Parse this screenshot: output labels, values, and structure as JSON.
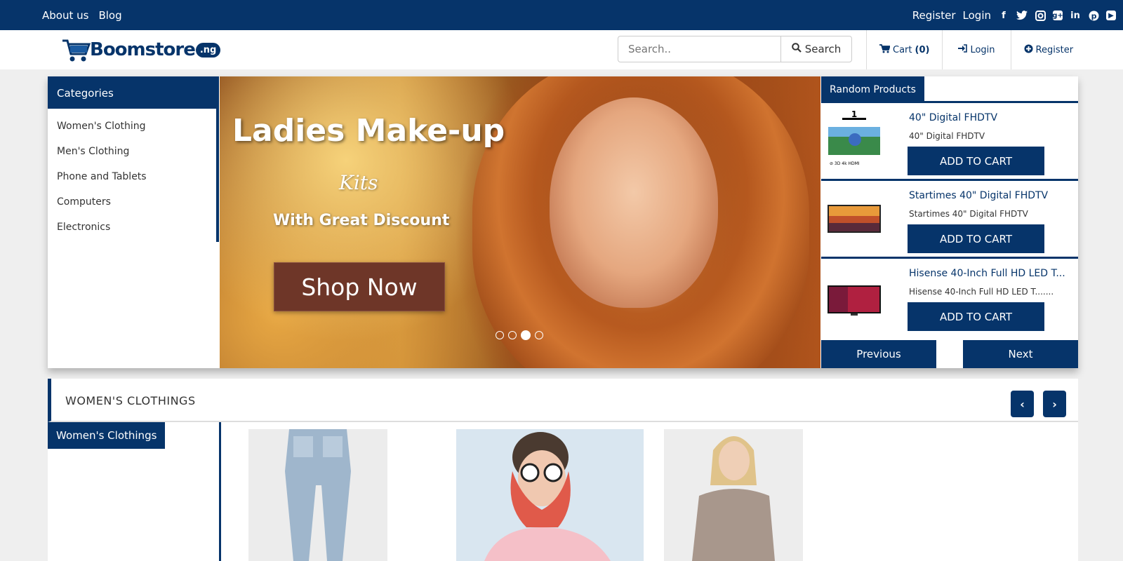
{
  "topbar": {
    "left_links": [
      "About us",
      "Blog"
    ],
    "register": "Register",
    "login": "Login"
  },
  "header": {
    "logo_name": "Boomstore",
    "logo_tld": ".ng",
    "search_placeholder": "Search..",
    "search_button": "Search",
    "cart_label": "Cart",
    "cart_count": "(0)",
    "login": "Login",
    "register": "Register"
  },
  "categories": {
    "title": "Categories",
    "items": [
      "Women's Clothing",
      "Men's Clothing",
      "Phone and Tablets",
      "Computers",
      "Electronics"
    ]
  },
  "banner": {
    "title": "Ladies Make-up",
    "kits": "Kits",
    "subtitle": "With Great Discount",
    "cta": "Shop Now",
    "slides_total": 4,
    "active_slide": 3
  },
  "random_products": {
    "title": "Random Products",
    "items": [
      {
        "title": "40\" Digital FHDTV",
        "desc": "40\" Digital FHDTV",
        "button": "ADD TO CART"
      },
      {
        "title": "Startimes 40\" Digital FHDTV",
        "desc": "Startimes 40\" Digital FHDTV",
        "button": "ADD TO CART"
      },
      {
        "title": "Hisense 40-Inch Full HD LED T...",
        "desc": "Hisense 40-Inch Full HD LED T.......",
        "button": "ADD TO CART"
      }
    ],
    "prev": "Previous",
    "next": "Next"
  },
  "section": {
    "title": "WOMEN'S CLOTHINGS",
    "tab": "Women's Clothings"
  },
  "colors": {
    "brand": "#06346a",
    "shop_button": "#6e3628"
  }
}
